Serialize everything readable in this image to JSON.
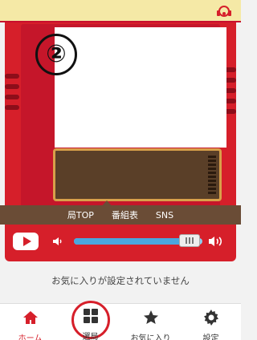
{
  "header": {
    "account_icon": "headphones-account-icon"
  },
  "radio": {
    "badge": "②",
    "links": [
      "局TOP",
      "番組表",
      "SNS"
    ]
  },
  "player": {
    "play_icon": "youtube-play-icon",
    "volume_low_icon": "speaker-low-icon",
    "volume_high_icon": "speaker-high-icon",
    "volume_level": 0.9
  },
  "favorites": {
    "message": "お気に入りが設定されていません"
  },
  "bottom_nav": [
    {
      "label": "ホーム",
      "icon": "home-icon",
      "active": true
    },
    {
      "label": "選局",
      "icon": "grid-icon",
      "active": false
    },
    {
      "label": "お気に入り",
      "icon": "star-icon",
      "active": false
    },
    {
      "label": "設定",
      "icon": "gear-icon",
      "active": false
    }
  ],
  "colors": {
    "accent": "#d61f2a",
    "panel": "#5a3f28",
    "header": "#f5e9a6"
  }
}
